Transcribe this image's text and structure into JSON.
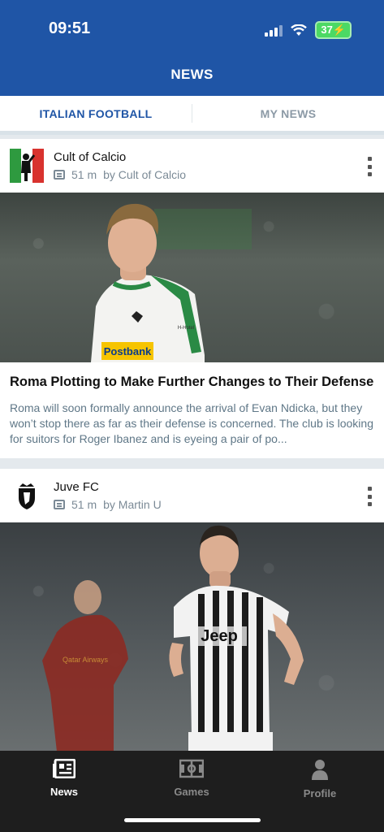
{
  "status": {
    "time": "09:51",
    "battery": "37"
  },
  "header": {
    "title": "NEWS"
  },
  "tabs": [
    {
      "label": "ITALIAN FOOTBALL",
      "active": true
    },
    {
      "label": "MY NEWS",
      "active": false
    }
  ],
  "articles": [
    {
      "source": "Cult of Calcio",
      "age": "51 m",
      "author": "by Cult of Calcio",
      "headline": "Roma Plotting to Make Further Changes to Their Defense",
      "summary": "Roma will soon formally announce the arrival of Evan Ndicka, but they won’t stop there as far as their defense is concerned. The club is looking for suitors for Roger Ibanez and is eyeing a pair of po...",
      "photo_sponsor": "Postbank",
      "photo_jersey_text": "H-Hotel"
    },
    {
      "source": "Juve FC",
      "age": "51 m",
      "author": "by Martin U",
      "photo_sponsor": "Jeep"
    }
  ],
  "bottom_nav": [
    {
      "label": "News",
      "icon": "newspaper-icon",
      "active": true
    },
    {
      "label": "Games",
      "icon": "pitch-icon",
      "active": false
    },
    {
      "label": "Profile",
      "icon": "person-icon",
      "active": false
    }
  ],
  "colors": {
    "brand_blue": "#1f55a6",
    "nav_bg": "#1e1e1e",
    "muted_text": "#5f7787"
  }
}
